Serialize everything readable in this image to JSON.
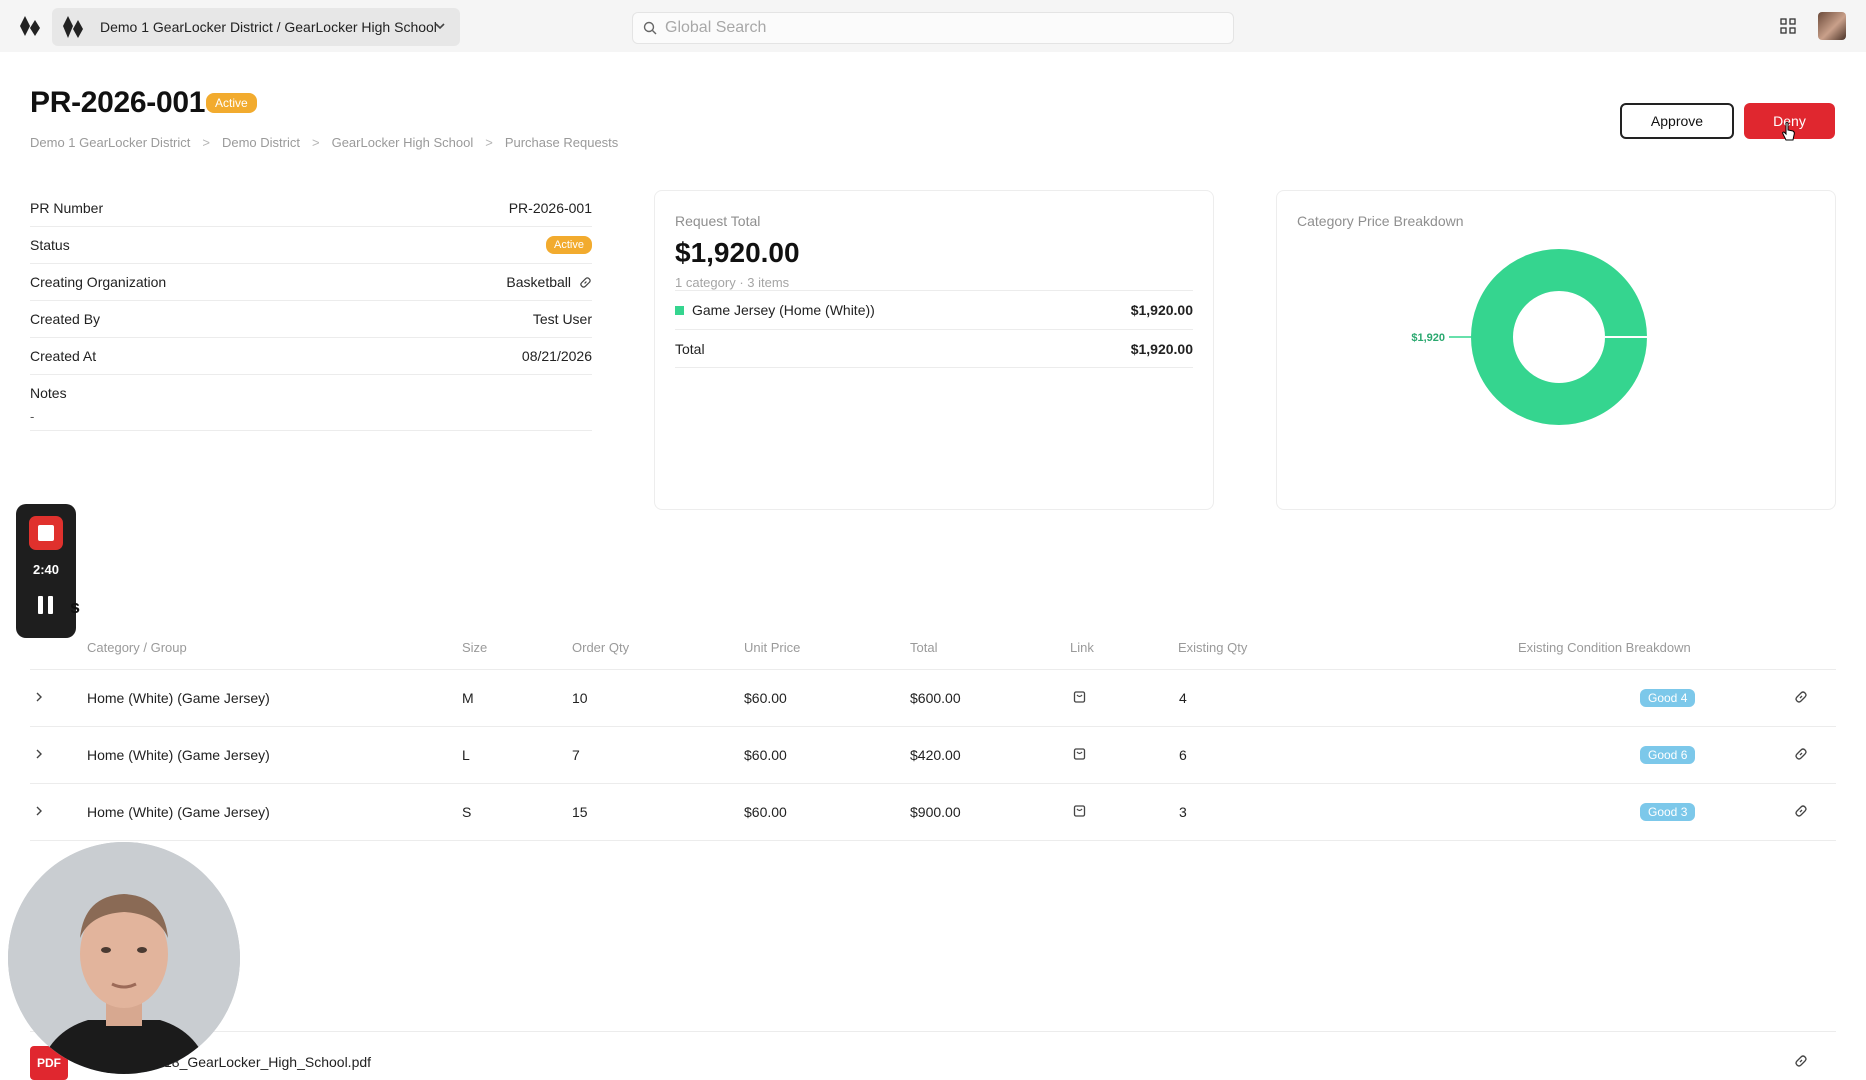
{
  "topbar": {
    "org_switcher_label": "Demo 1 GearLocker District / GearLocker High School",
    "search_placeholder": "Global Search",
    "search_value": ""
  },
  "header": {
    "title": "PR-2026-001",
    "status_badge": "Active",
    "breadcrumb": [
      "Demo 1 GearLocker District",
      "Demo District",
      "GearLocker High School",
      "Purchase Requests"
    ],
    "breadcrumb_sep": ">",
    "approve_label": "Approve",
    "deny_label": "Deny"
  },
  "details": {
    "rows": [
      {
        "label": "PR Number",
        "value": "PR-2026-001"
      },
      {
        "label": "Status",
        "value": "Active"
      },
      {
        "label": "Creating Organization",
        "value": "Basketball"
      },
      {
        "label": "Created By",
        "value": "Test User"
      },
      {
        "label": "Created At",
        "value": "08/21/2026"
      }
    ],
    "notes_label": "Notes",
    "notes_value": "-"
  },
  "request_total": {
    "heading": "Request Total",
    "amount": "$1,920.00",
    "subtitle": "1 category · 3 items",
    "lines": [
      {
        "name": "Game Jersey (Home (White))",
        "amount": "$1,920.00"
      }
    ],
    "total_label": "Total",
    "total_amount": "$1,920.00",
    "swatch_color": "#35d58f"
  },
  "chart_data": {
    "type": "pie",
    "title": "Category Price Breakdown",
    "categories": [
      "Game Jersey (Home (White))"
    ],
    "values": [
      1920
    ],
    "data_labels": [
      "$1,920"
    ],
    "colors": [
      "#35d58f"
    ],
    "donut": true
  },
  "recorder": {
    "time": "2:40"
  },
  "items_section": {
    "title_fragment": "s"
  },
  "table": {
    "columns": [
      "Category / Group",
      "Size",
      "Order Qty",
      "Unit Price",
      "Total",
      "Link",
      "Existing Qty",
      "Existing Condition Breakdown"
    ],
    "rows": [
      {
        "group": "Home (White) (Game Jersey)",
        "size": "M",
        "qty": "10",
        "unit_price": "$60.00",
        "total": "$600.00",
        "existing_qty": "4",
        "condition": "Good 4"
      },
      {
        "group": "Home (White) (Game Jersey)",
        "size": "L",
        "qty": "7",
        "unit_price": "$60.00",
        "total": "$420.00",
        "existing_qty": "6",
        "condition": "Good 6"
      },
      {
        "group": "Home (White) (Game Jersey)",
        "size": "S",
        "qty": "15",
        "unit_price": "$60.00",
        "total": "$900.00",
        "existing_qty": "3",
        "condition": "Good 3"
      }
    ]
  },
  "attachment": {
    "badge": "PDF",
    "file_name": "18_GearLocker_High_School.pdf"
  },
  "colors": {
    "accent_green": "#35d58f",
    "status_orange": "#f2ab2e",
    "deny_red": "#e0272f",
    "good_blue": "#7cc8ea"
  }
}
